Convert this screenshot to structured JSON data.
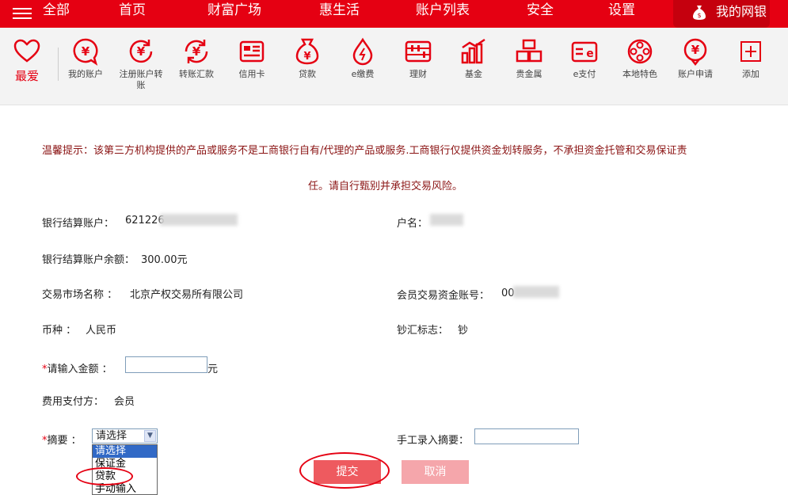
{
  "topnav": {
    "items": [
      "全部",
      "首页",
      "财富广场",
      "惠生活",
      "账户列表",
      "安全",
      "设置"
    ],
    "mybank": "我的网银"
  },
  "iconbar": {
    "favorite": "最爱",
    "items": [
      {
        "label": "我的账户",
        "icon": "yuan-speech-icon"
      },
      {
        "label": "注册账户转账",
        "icon": "yuan-refresh-icon"
      },
      {
        "label": "转账汇款",
        "icon": "yuan-transfer-icon"
      },
      {
        "label": "信用卡",
        "icon": "credit-card-icon"
      },
      {
        "label": "贷款",
        "icon": "money-bag-icon"
      },
      {
        "label": "e缴费",
        "icon": "droplet-icon"
      },
      {
        "label": "理财",
        "icon": "abacus-icon"
      },
      {
        "label": "基金",
        "icon": "bar-chart-icon"
      },
      {
        "label": "贵金属",
        "icon": "gold-bars-icon"
      },
      {
        "label": "e支付",
        "icon": "e-pay-icon"
      },
      {
        "label": "本地特色",
        "icon": "reel-icon"
      },
      {
        "label": "账户申请",
        "icon": "yuan-apply-icon"
      },
      {
        "label": "添加",
        "icon": "plus-icon"
      }
    ]
  },
  "notice": {
    "line1": "温馨提示：该第三方机构提供的产品或服务不是工商银行自有/代理的产品或服务.工商银行仅提供资金划转服务，不承担资金托管和交易保证责",
    "line2": "任。请自行甄别并承担交易风险。"
  },
  "form": {
    "account_label": "银行结算账户：",
    "account_value": "621226",
    "name_label": "户名：",
    "balance_label": "银行结算账户余额：",
    "balance_value": "300.00元",
    "market_label": "交易市场名称 ：",
    "market_value": "北京产权交易所有限公司",
    "member_acct_label": "会员交易资金账号：",
    "member_acct_value": "00",
    "currency_label": "币种 ：",
    "currency_value": "人民币",
    "cashflag_label": "钞汇标志：",
    "cashflag_value": "钞",
    "amount_label": "请输入金额 ：",
    "amount_value": "",
    "amount_unit": "元",
    "fee_label": "费用支付方：",
    "fee_value": "会员",
    "summary_label": "摘要 ：",
    "summary_selected": "请选择",
    "summary_options": [
      "请选择",
      "保证金",
      "贷款",
      "手动输入"
    ],
    "manual_label": "手工录入摘要：",
    "manual_value": "",
    "required_mark": "*"
  },
  "buttons": {
    "submit": "提交",
    "cancel": "取消"
  },
  "colors": {
    "brand": "#e50012",
    "notice": "#8b1414",
    "submit": "#ee5a5f",
    "cancel": "#f5a6ab"
  }
}
